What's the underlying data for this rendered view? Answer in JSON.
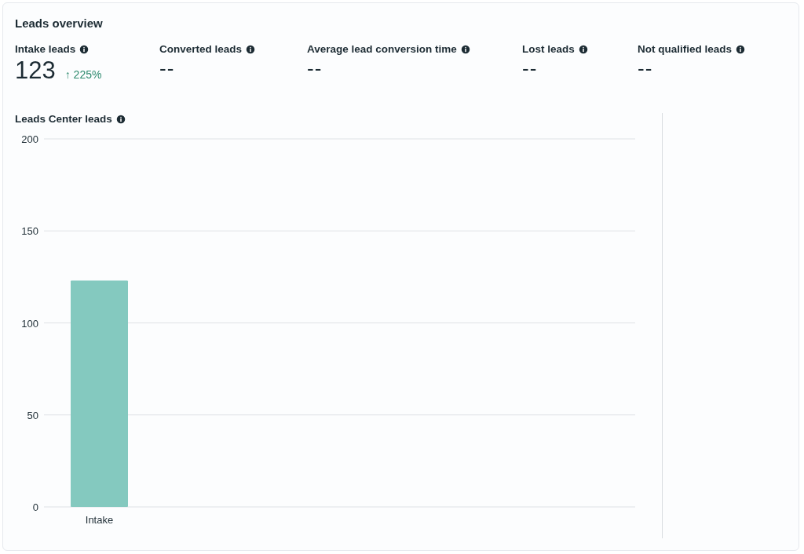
{
  "title": "Leads overview",
  "metrics": [
    {
      "label": "Intake leads",
      "value": "123",
      "change": "↑ 225%"
    },
    {
      "label": "Converted leads",
      "value": "--"
    },
    {
      "label": "Average lead conversion time",
      "value": "--"
    },
    {
      "label": "Lost leads",
      "value": "--"
    },
    {
      "label": "Not qualified leads",
      "value": "--"
    }
  ],
  "chart_title": "Leads Center leads",
  "chart_data": {
    "type": "bar",
    "categories": [
      "Intake"
    ],
    "series": [
      {
        "color": "#84c9bf",
        "values": [
          123
        ]
      }
    ],
    "grid": true,
    "ylim": [
      0,
      200
    ],
    "yticks": [
      0,
      50,
      100,
      150,
      200
    ]
  }
}
